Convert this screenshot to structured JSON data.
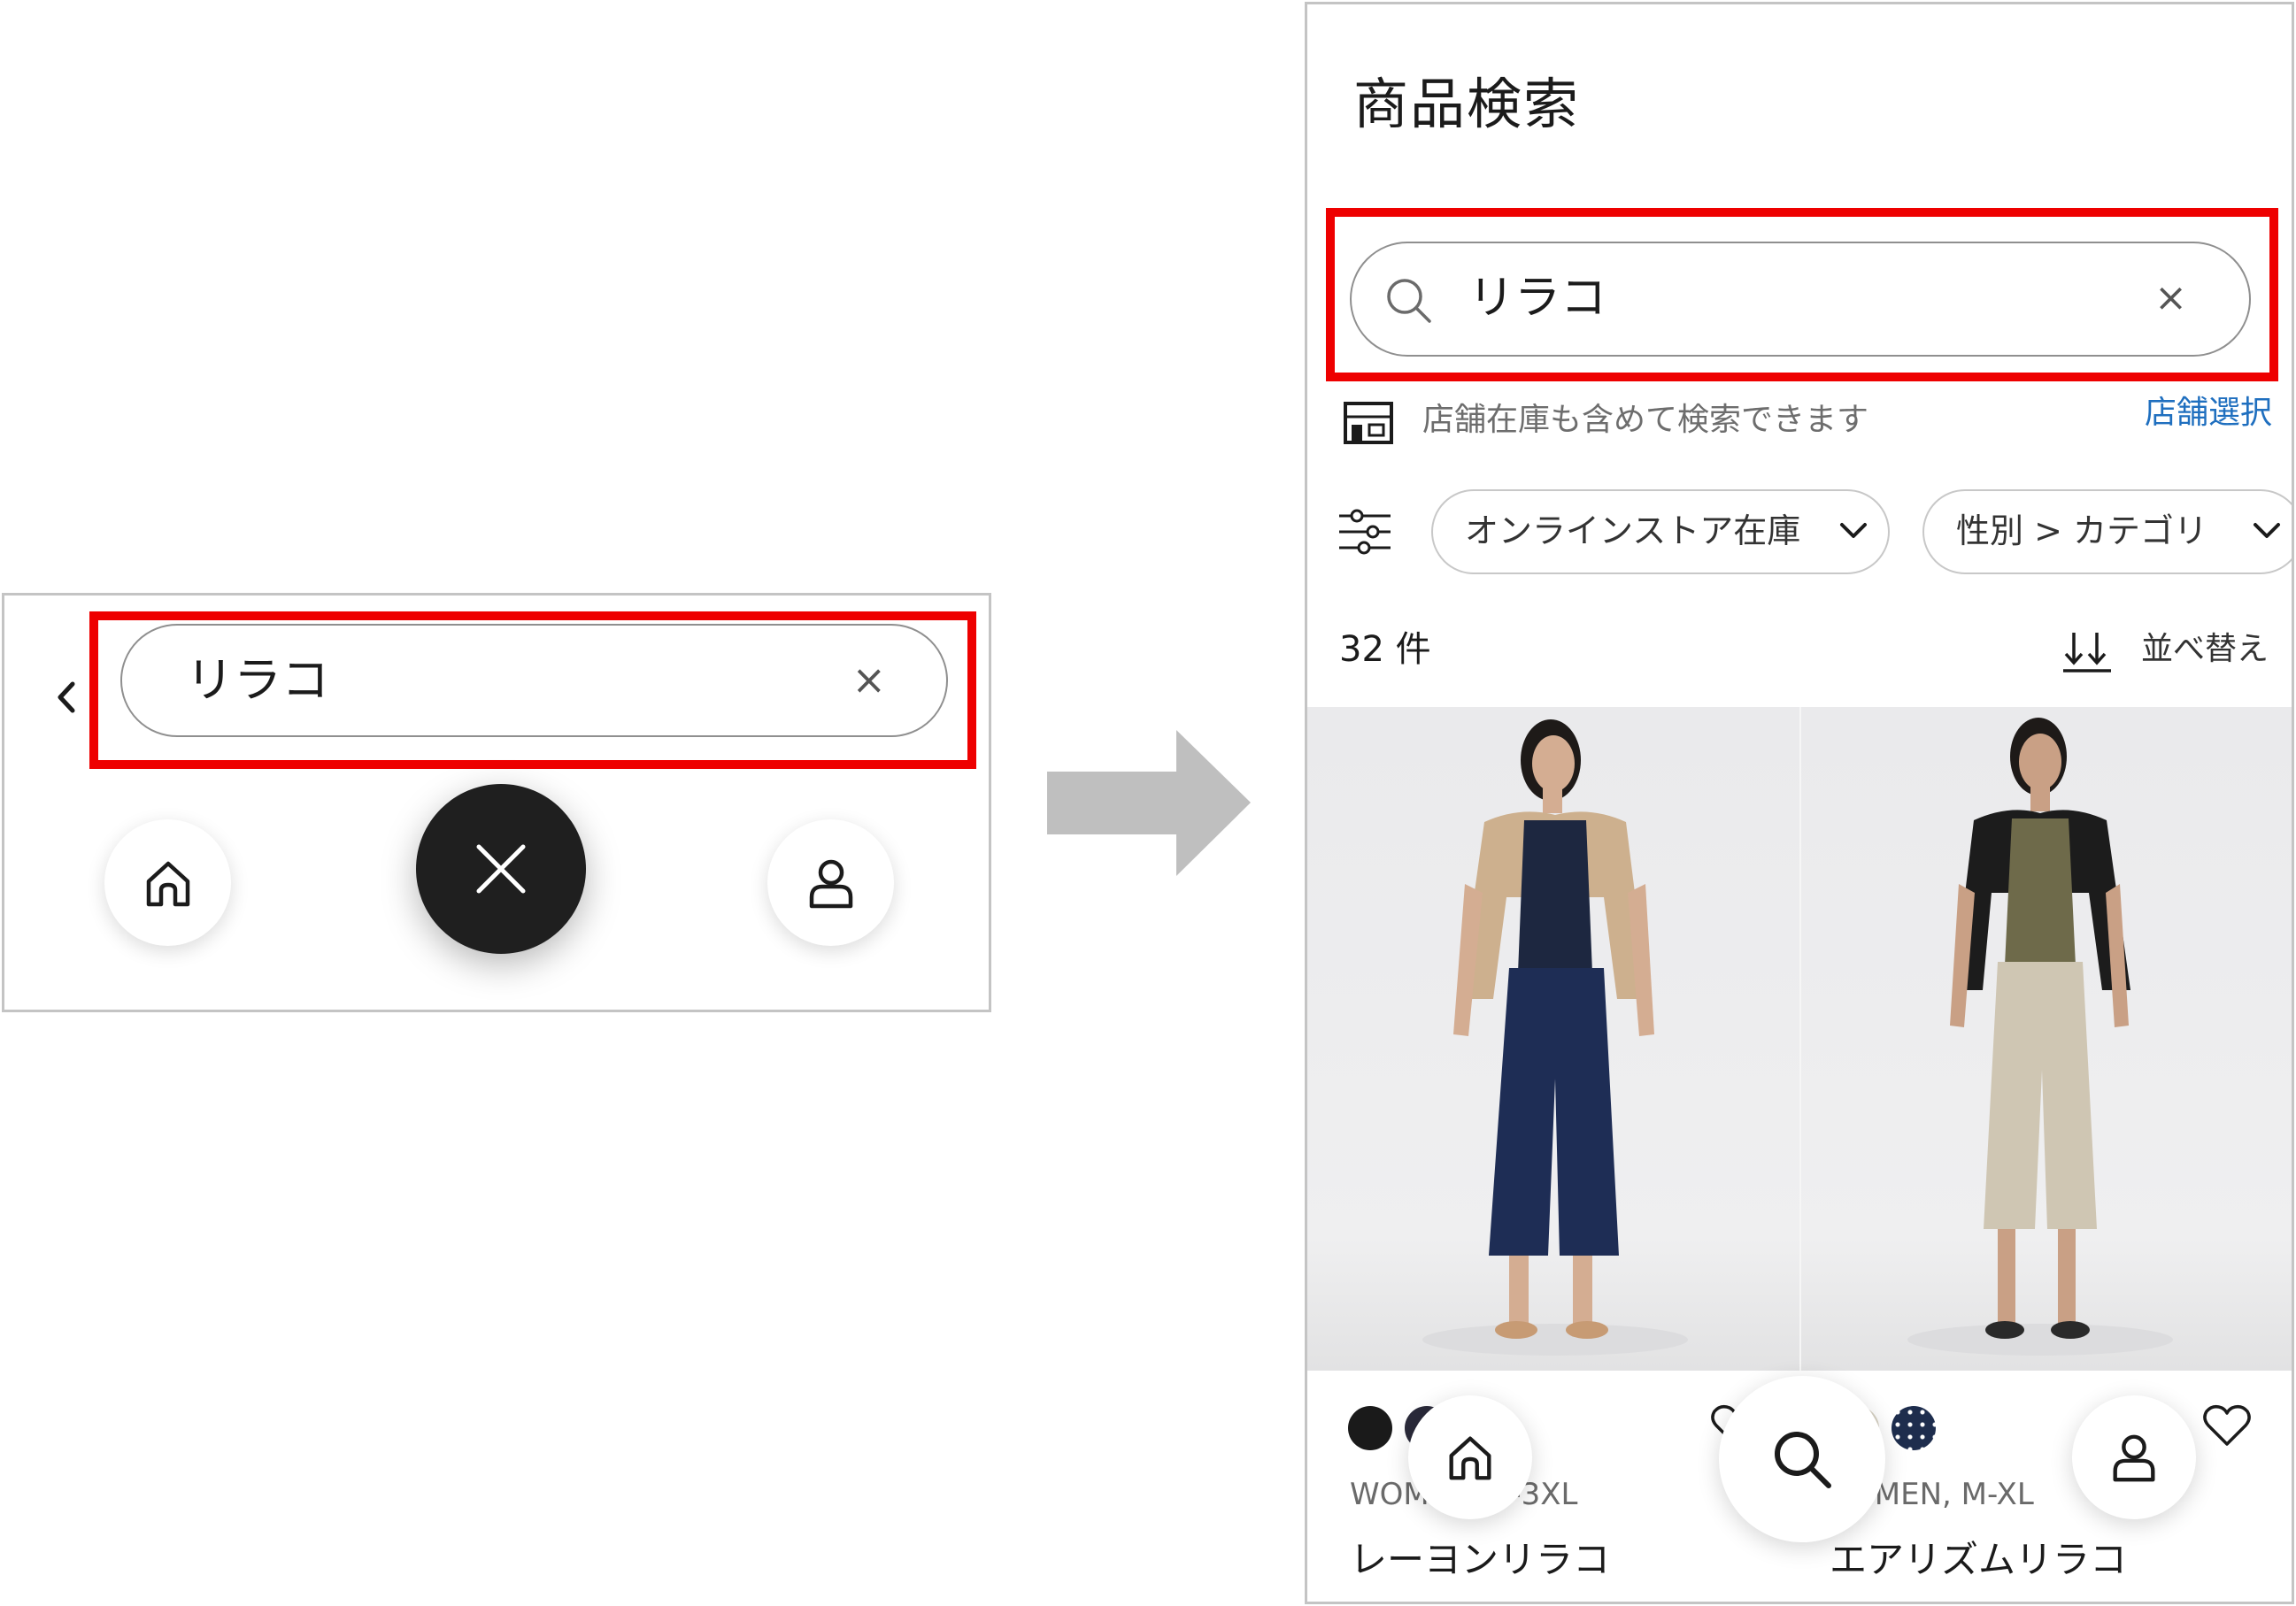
{
  "before": {
    "back_icon": "chevron-left-icon",
    "search": {
      "query": "リラコ",
      "clear_label": "×"
    },
    "nav": {
      "home_icon": "home-icon",
      "close_icon": "close-icon",
      "user_icon": "user-icon"
    }
  },
  "transition_arrow": {
    "color": "#bfbfbf"
  },
  "after": {
    "page_title": "商品検索",
    "search": {
      "query": "リラコ",
      "clear_label": "×",
      "icon": "search-icon"
    },
    "store": {
      "text": "店舗在庫も含めて検索できます",
      "link": "店舗選択",
      "icon": "store-icon"
    },
    "filters": {
      "icon": "filter-sliders-icon",
      "chips": [
        {
          "label": "オンラインストア在庫"
        },
        {
          "label": "性別 > カテゴリ"
        }
      ]
    },
    "results": {
      "count": "32 件",
      "sort_label": "並べ替え"
    },
    "products": [
      {
        "sizes": "WOM",
        "sizes_tail": "S-3XL",
        "name": "レーヨンリラコ",
        "swatches": [
          "#1a1a1a",
          "#2a2a3a"
        ],
        "pants_color": "#1e2d55",
        "top_color": "#1d2740",
        "cardigan_color": "#cdb08e"
      },
      {
        "sizes": "OMEN, M-XL",
        "name": "エアリズムリラコ",
        "swatches": [
          "#d9d4c6",
          "#1e2d4d"
        ],
        "pants_color": "#cfc6b3",
        "top_color": "#6e6a4a",
        "cardigan_color": "#1c1c1c"
      }
    ],
    "nav": {
      "home_icon": "home-icon",
      "search_icon": "search-icon",
      "user_icon": "user-icon"
    }
  },
  "highlight_color": "#ee0000"
}
